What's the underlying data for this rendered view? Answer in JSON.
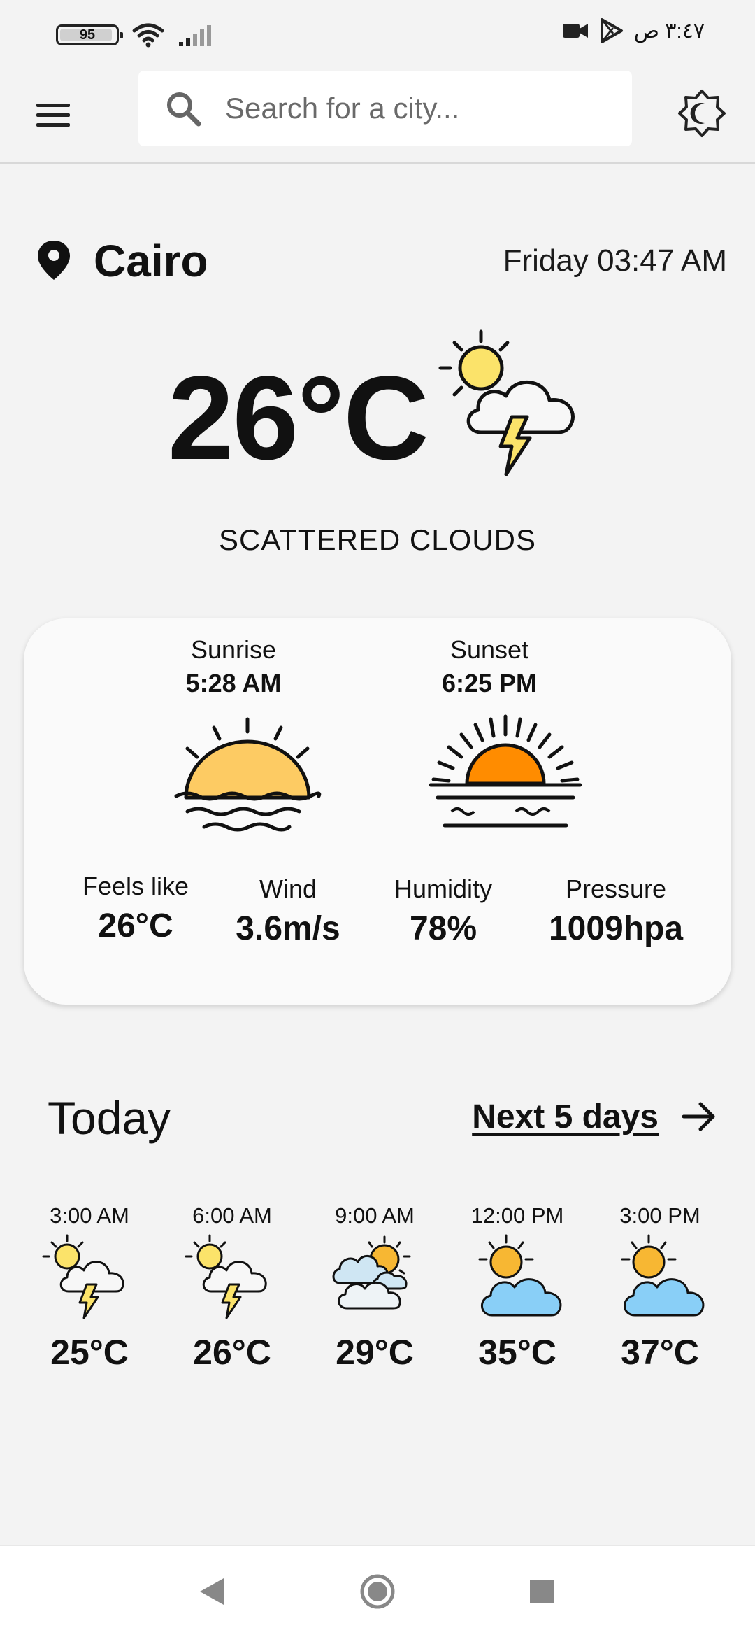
{
  "status_bar": {
    "battery_level": 95,
    "battery_text": "95",
    "time_text": "٣:٤٧ ص"
  },
  "header": {
    "search_placeholder": "Search for a city..."
  },
  "location": {
    "city": "Cairo",
    "datetime": "Friday 03:47 AM"
  },
  "current": {
    "temperature": "26°C",
    "condition": "SCATTERED CLOUDS",
    "icon": "sun-cloud-lightning-icon"
  },
  "details": {
    "sunrise_label": "Sunrise",
    "sunrise_time": "5:28 AM",
    "sunset_label": "Sunset",
    "sunset_time": "6:25 PM",
    "stats": [
      {
        "label": "Feels like",
        "value": "26°C"
      },
      {
        "label": "Wind",
        "value": "3.6m/s"
      },
      {
        "label": "Humidity",
        "value": "78%"
      },
      {
        "label": "Pressure",
        "value": "1009hpa"
      }
    ]
  },
  "forecast": {
    "title": "Today",
    "next_label": "Next 5 days",
    "hours": [
      {
        "time": "3:00 AM",
        "temp": "25°C",
        "icon": "sun-cloud-lightning-icon"
      },
      {
        "time": "6:00 AM",
        "temp": "26°C",
        "icon": "sun-cloud-lightning-icon"
      },
      {
        "time": "9:00 AM",
        "temp": "29°C",
        "icon": "sun-clouds-icon"
      },
      {
        "time": "12:00 PM",
        "temp": "35°C",
        "icon": "sun-blue-cloud-icon"
      },
      {
        "time": "3:00 PM",
        "temp": "37°C",
        "icon": "sun-blue-cloud-icon"
      }
    ]
  },
  "colors": {
    "background": "#f3f3f3",
    "card": "#fafafa",
    "sun_yellow": "#fdd663",
    "sun_orange": "#ff8c00",
    "sky_blue": "#89cff7"
  }
}
